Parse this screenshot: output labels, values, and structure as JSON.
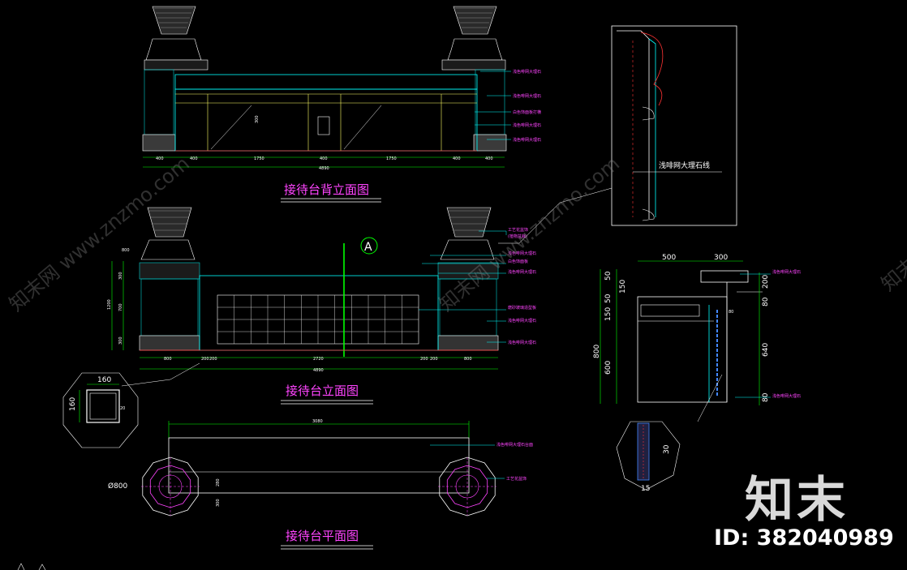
{
  "drawing": {
    "titles": {
      "back_elevation": "接待台背立面图",
      "front_elevation": "接待台立面图",
      "plan": "接待台平面图"
    },
    "section_marker": "A",
    "detail_label": "浅啡网大理石线",
    "back_elevation_dims": [
      "400",
      "400",
      "1750",
      "400",
      "1750",
      "400",
      "400"
    ],
    "back_elevation_total": "4890",
    "back_elevation_height": "300",
    "front_elevation_dims": [
      "800",
      "200",
      "200",
      "2720",
      "200",
      "200",
      "800"
    ],
    "front_elevation_total": "4890",
    "front_elevation_left_dims": [
      "800",
      "1200",
      "700",
      "300",
      "300"
    ],
    "plan_total": "3080",
    "plan_diameter": "Ø800",
    "plan_side_dims": [
      "280",
      "300"
    ],
    "section_dims": {
      "top": [
        "500",
        "300"
      ],
      "left": [
        "50",
        "150",
        "50",
        "150",
        "800",
        "600"
      ],
      "right": [
        "200",
        "80",
        "640",
        "80"
      ],
      "inner": "80"
    },
    "small_square_dims": [
      "160",
      "160",
      "20"
    ],
    "small_detail_dims": [
      "30",
      "15"
    ],
    "annotations": {
      "back": [
        "浅色啡网大理石",
        "浅色啡网大理石",
        "白色饰面板打横",
        "浅色啡网大理石",
        "浅色啡网大理石"
      ],
      "front": [
        "工艺花盆饰",
        "(植物盆栽)",
        "浅色啡网大理石",
        "白色饰面板",
        "浅色啡网大理石",
        "磨砂玻璃造型板",
        "浅色啡网大理石",
        "浅色啡网大理石"
      ],
      "plan": [
        "浅色啡网大理石台面",
        "工艺花盆饰"
      ],
      "section": [
        "浅色啡网大理石",
        "浅色啡网大理石"
      ]
    }
  },
  "watermarks": [
    "知末网 www.znzmo.com",
    "知末网 www.znzmo.com",
    "知末网 www.znzmo.com"
  ],
  "brand": {
    "logo_text": "知末",
    "id_text": "ID: 382040989"
  }
}
